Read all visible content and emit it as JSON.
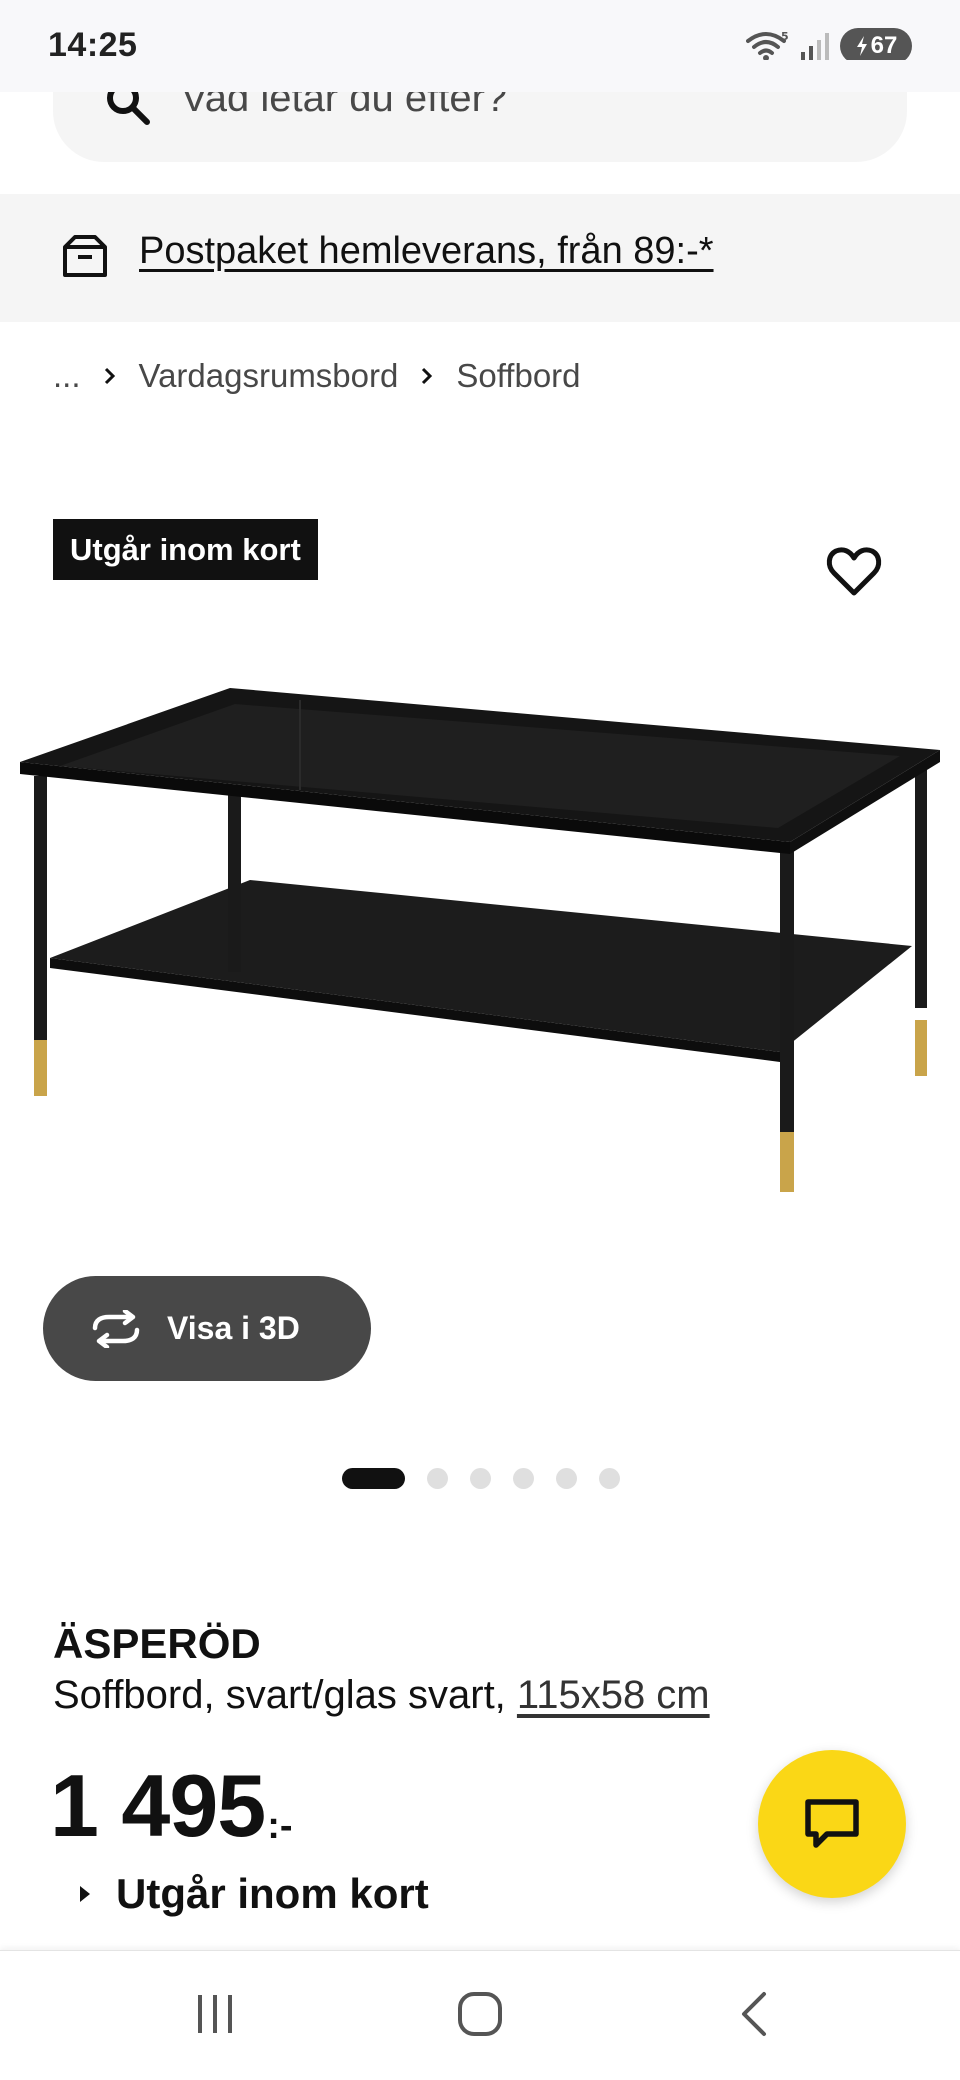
{
  "status_bar": {
    "time": "14:25",
    "battery": "67",
    "icons": [
      "wifi-icon",
      "signal-icon",
      "battery-charging-icon"
    ]
  },
  "search": {
    "placeholder": "Vad letar du efter?",
    "icon": "search-icon"
  },
  "promo": {
    "text": "Postpaket hemleverans, från 89:-*",
    "icon": "delivery-box-icon"
  },
  "breadcrumb": {
    "items": [
      "...",
      "Vardagsrumsbord",
      "Soffbord"
    ]
  },
  "badge": {
    "label": "Utgår inom kort"
  },
  "gallery": {
    "view_3d_label": "Visa i 3D",
    "slide_count": 6,
    "active_slide": 1
  },
  "product": {
    "name": "ÄSPERÖD",
    "description": "Soffbord, svart/glas svart,",
    "dimensions": "115x58 cm",
    "price": "1 495",
    "price_suffix": ":-",
    "availability": "Utgår inom kort"
  },
  "colors": {
    "accent_yellow": "#fad716",
    "badge_black": "#111111",
    "button_gray": "#484848"
  },
  "nav": {
    "icons": [
      "recent-apps-icon",
      "home-icon",
      "back-icon"
    ]
  }
}
